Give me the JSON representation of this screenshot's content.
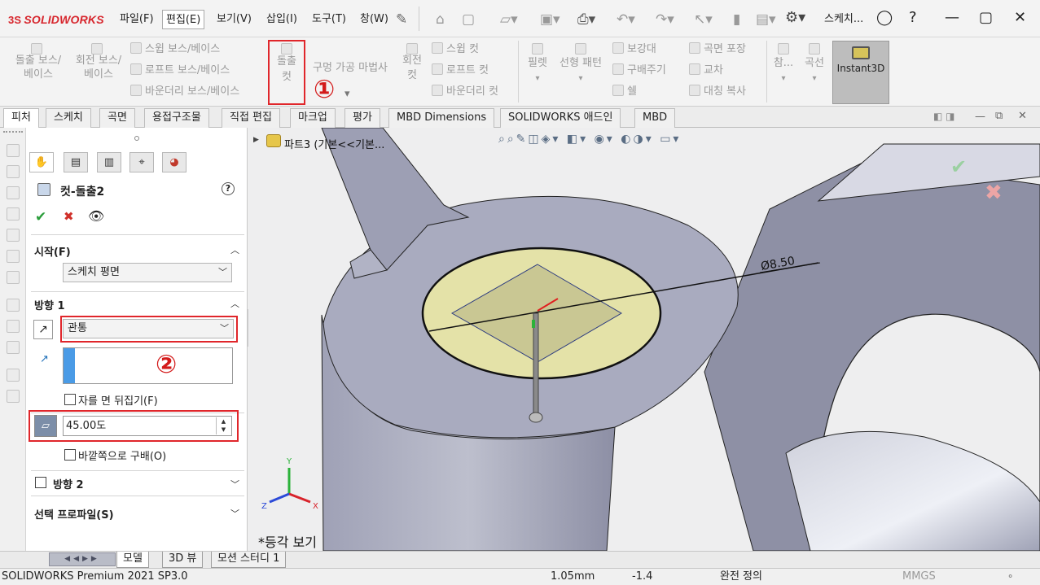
{
  "app": {
    "logo_text": "SOLIDWORKS",
    "logo_mark": "3S",
    "accent": "#d7262d"
  },
  "menu": {
    "items": [
      "파일(F)",
      "편집(E)",
      "보기(V)",
      "삽입(I)",
      "도구(T)",
      "창(W)"
    ],
    "selected_index": 1,
    "doc_title": "스케치..."
  },
  "ribbon": {
    "extrude_boss": "돌출 보스/\n베이스",
    "revolve_boss": "회전 보스/\n베이스",
    "sweep_boss": "스윕 보스/베이스",
    "loft_boss": "로프트 보스/베이스",
    "boundary_boss": "바운더리 보스/베이스",
    "extrude_cut": "돌출\n컷",
    "hole_wizard": "구멍 가공 마법사",
    "revolve_cut": "회전\n컷",
    "sweep_cut": "스윕 컷",
    "loft_cut": "로프트 컷",
    "boundary_cut": "바운더리 컷",
    "fillet": "필렛",
    "linear_pattern": "선형 패턴",
    "rib": "보강대",
    "draft": "구배주기",
    "shell": "쉘",
    "wrap": "곡면 포장",
    "intersect": "교차",
    "mirror": "대칭 복사",
    "ref_geometry": "참...",
    "curves": "곡선",
    "instant3d": "Instant3D",
    "callout_1": "①"
  },
  "cm_tabs": [
    "피처",
    "스케치",
    "곡면",
    "용접구조물",
    "직접 편집",
    "마크업",
    "평가",
    "MBD Dimensions",
    "SOLIDWORKS 애드인",
    "MBD"
  ],
  "pm": {
    "title": "컷-돌출2",
    "help": "?",
    "ok": "✔",
    "cancel": "✖",
    "from_label": "시작(F)",
    "from_value": "스케치 평면",
    "dir1_label": "방향 1",
    "end_condition": "관통",
    "callout_2": "②",
    "flip_side": "자를 면 뒤집기(F)",
    "draft_angle": "45.00도",
    "draft_outward": "바깥쪽으로 구배(O)",
    "dir2_label": "방향 2",
    "selected_contours": "선택 프로파일(S)"
  },
  "viewport": {
    "tree_label": "파트3  (기본<<기본...",
    "dimension": "Ø8.50",
    "view_name": "*등각 보기",
    "axis_x": "X",
    "axis_y": "Y",
    "axis_z": "Z"
  },
  "bottom_tabs": [
    "모델",
    "3D 뷰",
    "모션 스터디 1"
  ],
  "status": {
    "product": "SOLIDWORKS Premium 2021 SP3.0",
    "value1": "1.05mm",
    "value2": "-1.4",
    "state": "완전 정의",
    "units": "MMGS"
  },
  "colors": {
    "highlight_red": "#e0262b",
    "viewport_bg": "#eeeeef",
    "cut_face": "#e4e2a8",
    "model_body": "#8c8ea5"
  }
}
